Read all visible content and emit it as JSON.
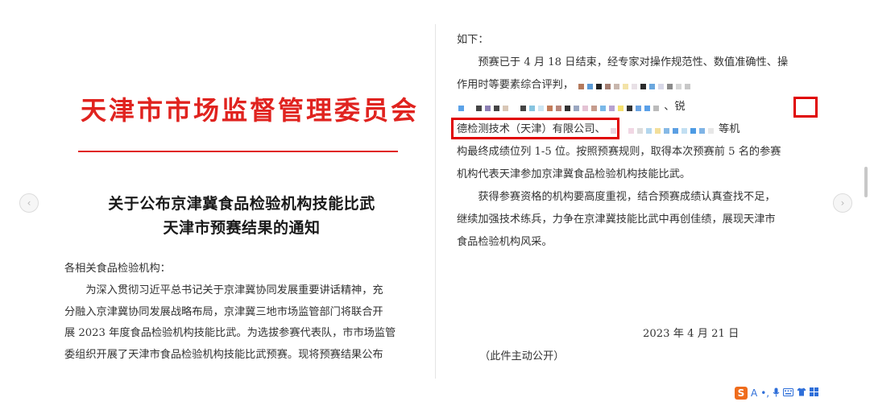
{
  "document": {
    "issuer": "天津市市场监督管理委员会",
    "title_line1": "关于公布京津冀食品检验机构技能比武",
    "title_line2": "天津市预赛结果的通知",
    "salutation": "各相关食品检验机构：",
    "paragraph1": [
      "　　为深入贯彻习近平总书记关于京津冀协同发展重要讲话精神，充",
      "分融入京津冀协同发展战略布局，京津冀三地市场监管部门将联合开",
      "展 2023 年度食品检验机构技能比武。为选拔参赛代表队，市市场监管",
      "委组织开展了天津市食品检验机构技能比武预赛。现将预赛结果公布"
    ],
    "right_lines": {
      "l1": "如下：",
      "l2": "　　预赛已于 4 月 18 日结束，经专家对操作规范性、数值准确性、操",
      "l3": "作用时等要素综合评判，",
      "l4_end": "、锐",
      "l5_start": "德检测技术（天津）有限公司",
      "l5_sep": "、",
      "l5_end": "等机",
      "l6": "构最终成绩位列 1-5 位。按照预赛规则，取得本次预赛前 5 名的参赛",
      "l7": "机构代表天津参加京津冀食品检验机构技能比武。",
      "l8": "　　获得参赛资格的机构要高度重视，结合预赛成绩认真查找不足，",
      "l9": "继续加强技术练兵，力争在京津冀技能比武中再创佳绩，展现天津市",
      "l10": "食品检验机构风采。"
    },
    "date": "2023 年 4 月 21 日",
    "disclosure": "（此件主动公开）"
  },
  "colors": {
    "issuer_red": "#e0231f",
    "highlight_red": "#e00000"
  },
  "navigation": {
    "prev_icon": "chevron-left-icon",
    "next_icon": "chevron-right-icon",
    "prev_glyph": "‹",
    "next_glyph": "›"
  },
  "ime_toolbar": {
    "logo": "S",
    "icons": [
      "logo-s-icon",
      "text-a-icon",
      "punctuation-icon",
      "microphone-icon",
      "keyboard-icon",
      "shirt-skin-icon",
      "grid-apps-icon"
    ]
  }
}
